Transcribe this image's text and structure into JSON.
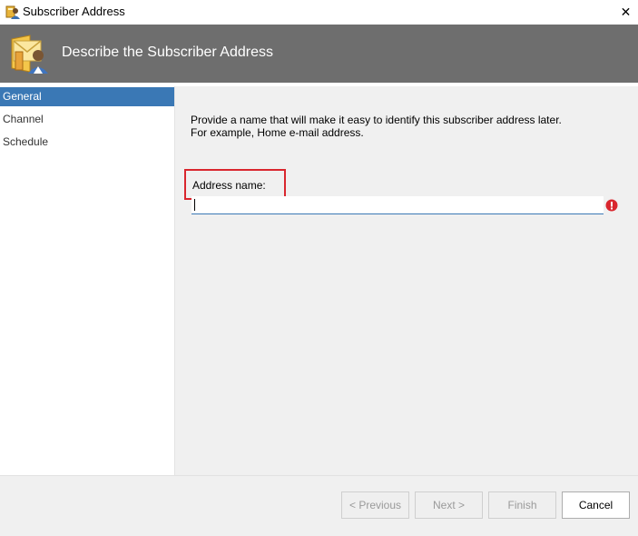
{
  "window": {
    "title": "Subscriber Address",
    "close_glyph": "✕"
  },
  "banner": {
    "title": "Describe the Subscriber Address",
    "icon": "subscriber-icon"
  },
  "nav": {
    "items": [
      {
        "label": "General",
        "selected": true
      },
      {
        "label": "Channel",
        "selected": false
      },
      {
        "label": "Schedule",
        "selected": false
      }
    ]
  },
  "content": {
    "description_line1": "Provide a name that will make it easy to identify this subscriber address later.",
    "description_line2": "For example, Home e-mail address.",
    "address_name_label": "Address name:",
    "address_name_value": "",
    "validation_icon": "error-icon"
  },
  "footer": {
    "previous_label": "< Previous",
    "next_label": "Next >",
    "finish_label": "Finish",
    "cancel_label": "Cancel"
  },
  "colors": {
    "banner_bg": "#6e6e6e",
    "selected_nav_bg": "#3a78b5",
    "highlight_border": "#d9262e",
    "error_red": "#d9262e"
  }
}
